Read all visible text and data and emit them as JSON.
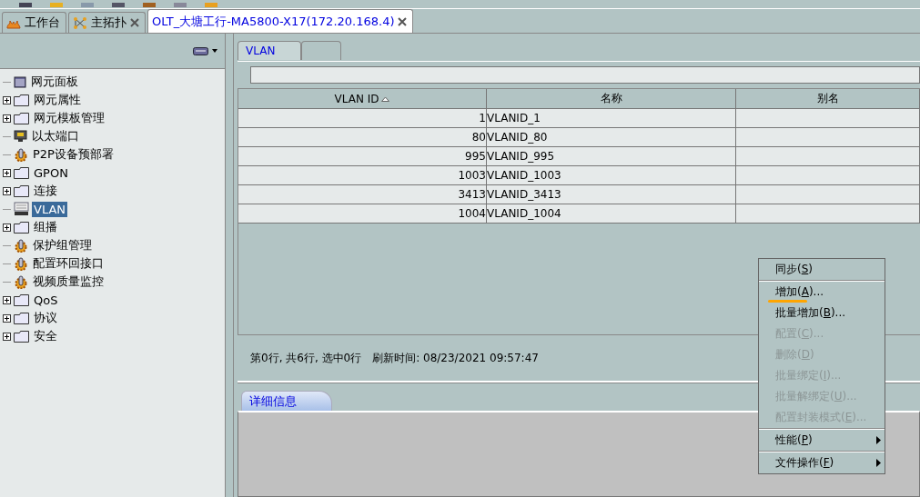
{
  "doc_tabs": [
    {
      "label": "工作台",
      "kind": "workbench",
      "closable": false,
      "selected": false
    },
    {
      "label": "主拓扑",
      "kind": "topology",
      "closable": true,
      "selected": false
    },
    {
      "label": "OLT_大塘工行-MA5800-X17(172.20.168.4)",
      "kind": "device",
      "closable": true,
      "selected": true
    }
  ],
  "tree": [
    {
      "label": "网元面板",
      "kind": "panel",
      "expandable": false,
      "selected": false
    },
    {
      "label": "网元属性",
      "kind": "folder",
      "expandable": true,
      "selected": false
    },
    {
      "label": "网元模板管理",
      "kind": "folder",
      "expandable": true,
      "selected": false
    },
    {
      "label": "以太端口",
      "kind": "port",
      "expandable": false,
      "selected": false
    },
    {
      "label": "P2P设备预部署",
      "kind": "gear",
      "expandable": false,
      "selected": false
    },
    {
      "label": "GPON",
      "kind": "folder",
      "expandable": true,
      "selected": false
    },
    {
      "label": "连接",
      "kind": "folder",
      "expandable": true,
      "selected": false
    },
    {
      "label": "VLAN",
      "kind": "vlan",
      "expandable": false,
      "selected": true
    },
    {
      "label": "组播",
      "kind": "folder",
      "expandable": true,
      "selected": false
    },
    {
      "label": "保护组管理",
      "kind": "gear",
      "expandable": false,
      "selected": false
    },
    {
      "label": "配置环回接口",
      "kind": "gear",
      "expandable": false,
      "selected": false
    },
    {
      "label": "视频质量监控",
      "kind": "gear",
      "expandable": false,
      "selected": false
    },
    {
      "label": "QoS",
      "kind": "folder",
      "expandable": true,
      "selected": false
    },
    {
      "label": "协议",
      "kind": "folder",
      "expandable": true,
      "selected": false
    },
    {
      "label": "安全",
      "kind": "folder",
      "expandable": true,
      "selected": false
    }
  ],
  "view_tabs": [
    {
      "label": "VLAN",
      "selected": true
    },
    {
      "selected": false
    }
  ],
  "table": {
    "columns": [
      {
        "label": "VLAN ID",
        "sorted": true
      },
      {
        "label": "名称",
        "sorted": false
      },
      {
        "label": "别名",
        "sorted": false
      }
    ],
    "rows": [
      [
        "1",
        "VLANID_1"
      ],
      [
        "80",
        "VLANID_80"
      ],
      [
        "995",
        "VLANID_995"
      ],
      [
        "1003",
        "VLANID_1003"
      ],
      [
        "3413",
        "VLANID_3413"
      ],
      [
        "1004",
        "VLANID_1004"
      ]
    ]
  },
  "status": "第0行, 共6行, 选中0行",
  "refresh": "刷新时间: 08/23/2021 09:57:47",
  "detail_tab": "详细信息",
  "context_menu": [
    {
      "before": "同步(",
      "key": "S",
      "after": ")",
      "disabled": false,
      "submenu": false,
      "underlined": false,
      "separator_above": false
    },
    {
      "before": "增加(",
      "key": "A",
      "after": ")...",
      "disabled": false,
      "submenu": false,
      "underlined": true,
      "separator_above": true
    },
    {
      "before": "批量增加(",
      "key": "B",
      "after": ")...",
      "disabled": false,
      "submenu": false,
      "underlined": false,
      "separator_above": false
    },
    {
      "before": "配置(",
      "key": "C",
      "after": ")...",
      "disabled": true,
      "submenu": false,
      "underlined": false,
      "separator_above": false
    },
    {
      "before": "删除(",
      "key": "D",
      "after": ")",
      "disabled": true,
      "submenu": false,
      "underlined": false,
      "separator_above": false
    },
    {
      "before": "批量绑定(",
      "key": "I",
      "after": ")...",
      "disabled": true,
      "submenu": false,
      "underlined": false,
      "separator_above": false
    },
    {
      "before": "批量解绑定(",
      "key": "U",
      "after": ")...",
      "disabled": true,
      "submenu": false,
      "underlined": false,
      "separator_above": false
    },
    {
      "before": "配置封装模式(",
      "key": "E",
      "after": ")...",
      "disabled": true,
      "submenu": false,
      "underlined": false,
      "separator_above": false
    },
    {
      "before": "性能(",
      "key": "P",
      "after": ")",
      "disabled": false,
      "submenu": true,
      "underlined": false,
      "separator_above": true
    },
    {
      "before": "文件操作(",
      "key": "F",
      "after": ")",
      "disabled": false,
      "submenu": true,
      "underlined": false,
      "separator_above": true
    }
  ]
}
